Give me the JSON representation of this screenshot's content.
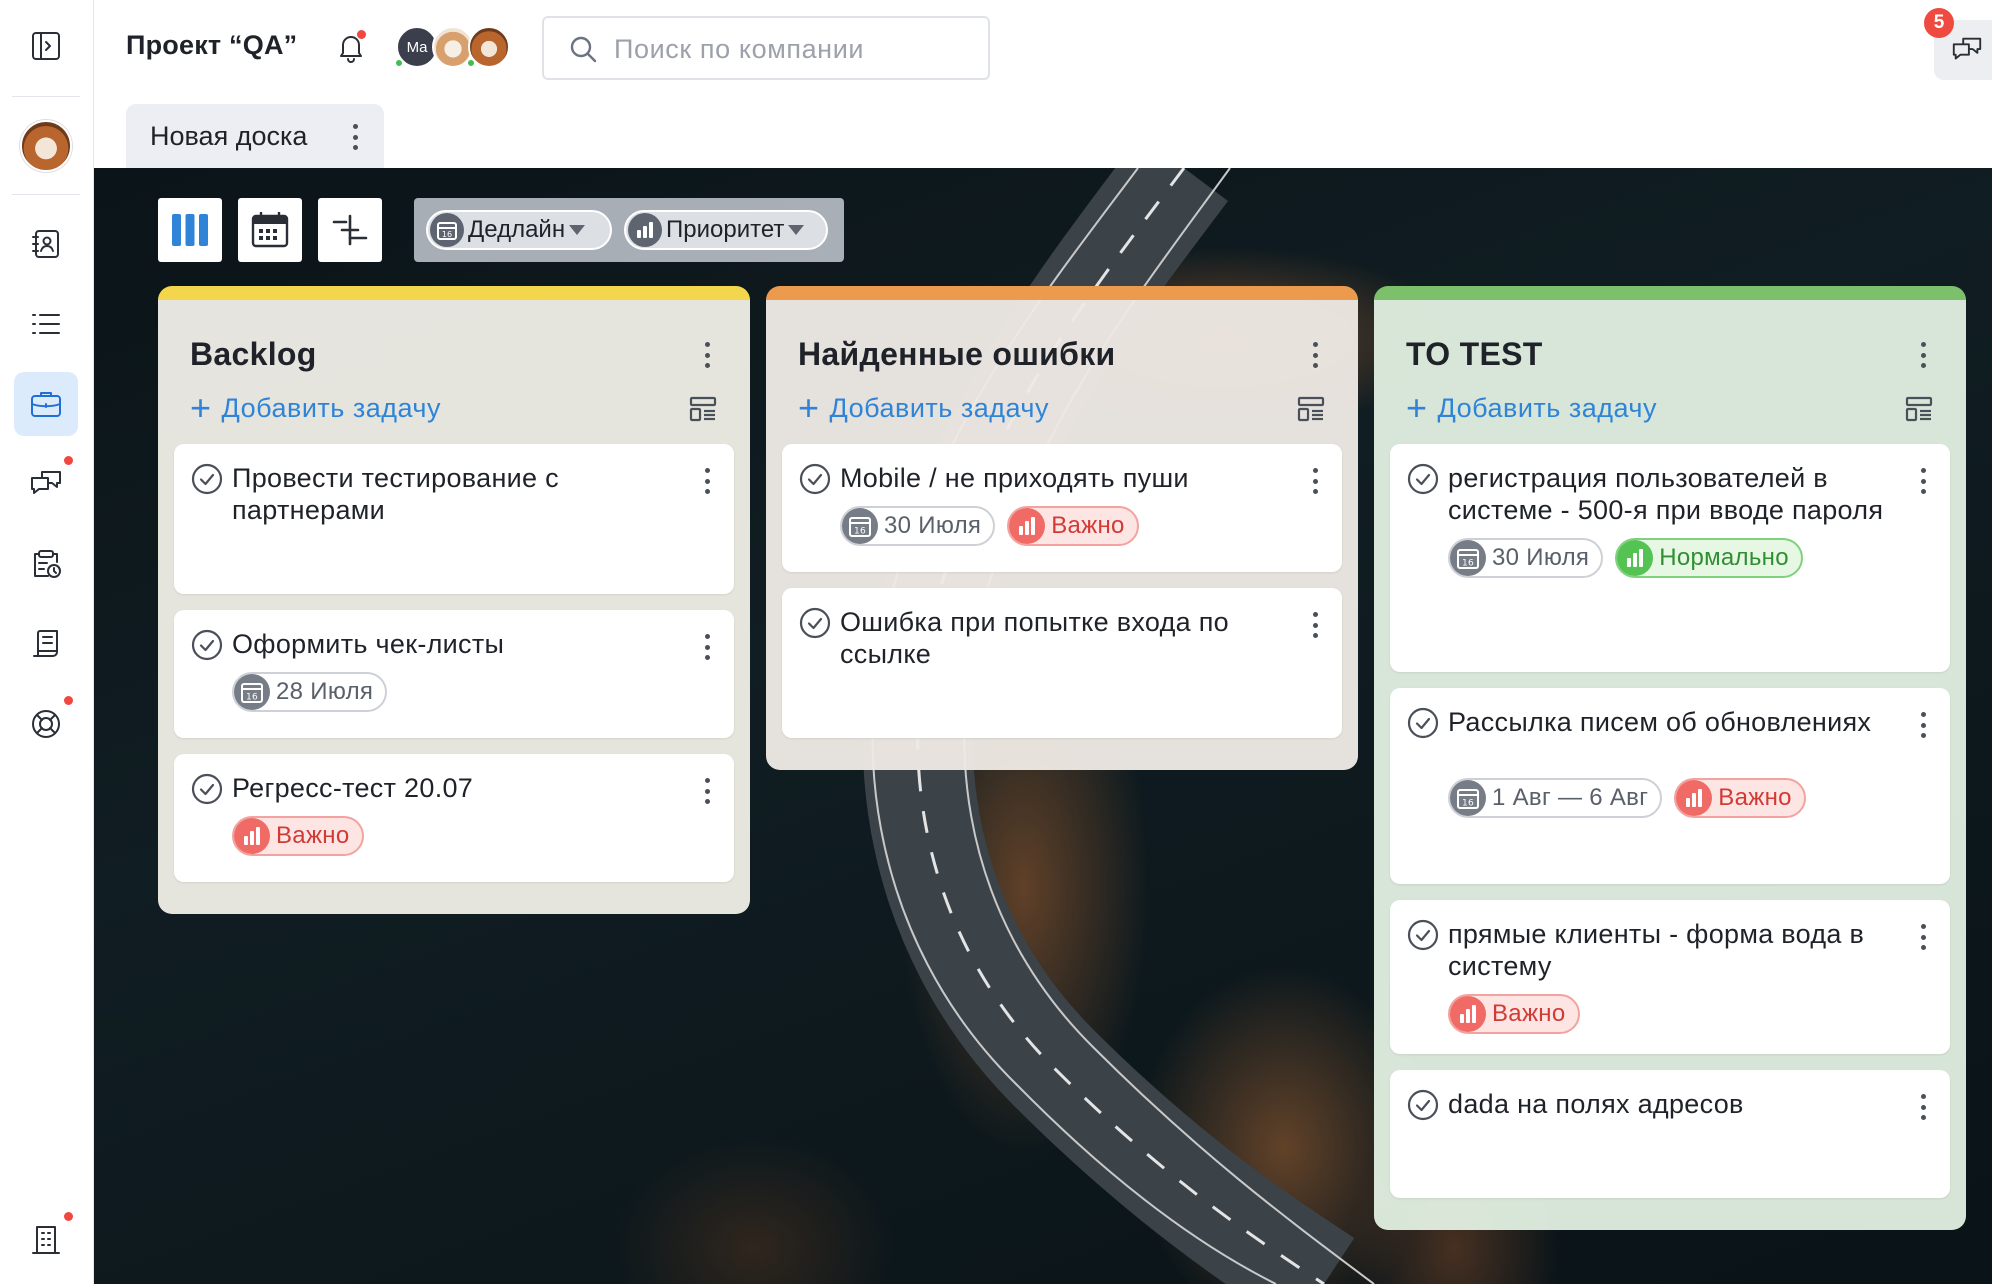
{
  "header": {
    "project_title": "Проект “QA”",
    "search_placeholder": "Поиск по компании",
    "avatar_initials": "Ma",
    "chat_badge": "5",
    "board_tab": "Новая доска"
  },
  "sidebar": {
    "items": [
      "sidebar-toggle",
      "contacts",
      "list",
      "projects",
      "chats",
      "tasks-clock",
      "documents",
      "support",
      "company"
    ],
    "active": "projects"
  },
  "filters": {
    "deadline": "Дедлайн",
    "priority": "Приоритет"
  },
  "colors": {
    "accent": "#2f84d8",
    "backlog": "#f4d64c",
    "found_bugs": "#ec9b4e",
    "to_test": "#7cc06c",
    "high_priority": "#f06b66",
    "normal_priority": "#55c254"
  },
  "columns": [
    {
      "title": "Backlog",
      "add_label": "Добавить задачу",
      "cards": [
        {
          "title": "Провести тестирование с партнерами",
          "date": "",
          "priority": ""
        },
        {
          "title": "Оформить чек-листы",
          "date": "28 Июля",
          "priority": ""
        },
        {
          "title": "Регресс-тест 20.07",
          "date": "",
          "priority": "Важно"
        }
      ]
    },
    {
      "title": "Найденные ошибки",
      "add_label": "Добавить задачу",
      "cards": [
        {
          "title": "Mobile / не приходять пуши",
          "date": "30 Июля",
          "priority": "Важно"
        },
        {
          "title": "Ошибка при попытке входа по ссылке",
          "date": "",
          "priority": ""
        }
      ]
    },
    {
      "title": "TO TEST",
      "add_label": "Добавить задачу",
      "cards": [
        {
          "title": "регистрация пользователей в системе - 500-я при вводе пароля",
          "date": "30 Июля",
          "priority": "Нормально"
        },
        {
          "title": "Рассылка писем об обновлениях",
          "date": "1 Авг — 6 Авг",
          "priority": "Важно"
        },
        {
          "title": "прямые клиенты - форма вода в систему",
          "date": "",
          "priority": "Важно"
        },
        {
          "title": "dada на полях адресов",
          "date": "",
          "priority": ""
        }
      ]
    }
  ]
}
